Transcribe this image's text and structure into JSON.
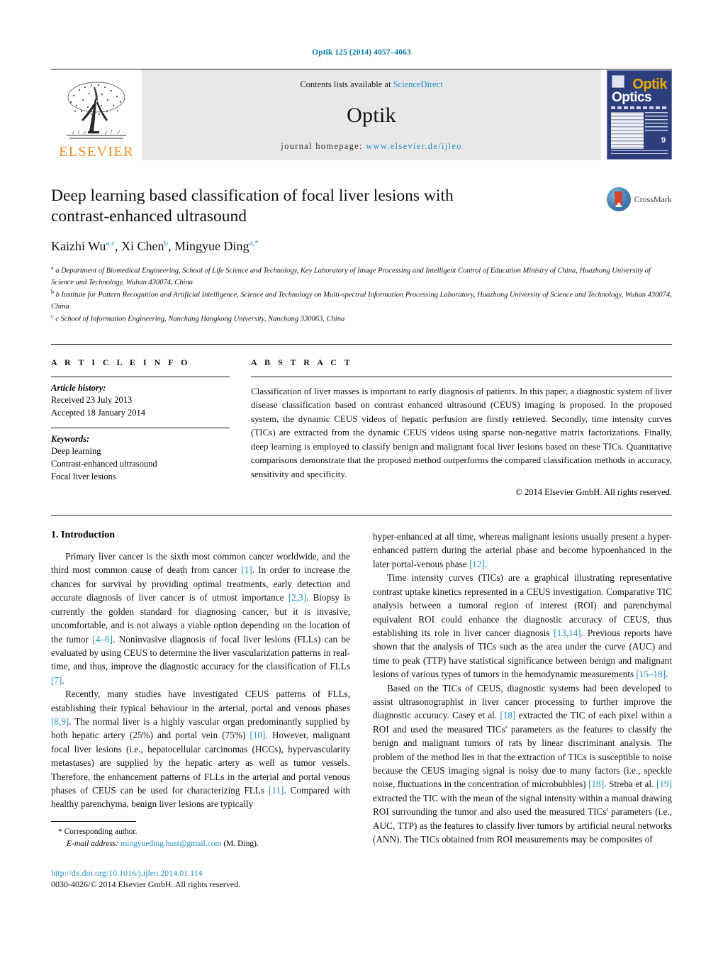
{
  "running_head": "Optik 125 (2014) 4057–4063",
  "masthead": {
    "publisher_name": "ELSEVIER",
    "contents_prefix": "Contents lists available at ",
    "sciencedirect": "ScienceDirect",
    "journal_title": "Optik",
    "homepage_prefix": "journal homepage: ",
    "homepage_url": "www.elsevier.de/ijleo",
    "cover": {
      "title_top": "Optik",
      "title_bottom": "Optics",
      "issue_number": "9"
    }
  },
  "article": {
    "title": "Deep learning based classification of focal liver lesions with contrast-enhanced ultrasound",
    "authors_html": "Kaizhi Wu<sup>a,c</sup>, Xi Chen<sup>b</sup>, Mingyue Ding<sup>a,*</sup>",
    "crossmark_label": "CrossMark",
    "affiliations": [
      "a Department of Biomedical Engineering, School of Life Science and Technology, Key Laboratory of Image Processing and Intelligent Control of Education Ministry of China, Huazhong University of Science and Technology, Wuhan 430074, China",
      "b Institute for Pattern Recognition and Artificial Intelligence, Science and Technology on Multi-spectral Information Processing Laboratory, Huazhong University of Science and Technology, Wuhan 430074, China",
      "c School of Information Engineering, Nanchang Hangkong University, Nanchang 330063, China"
    ]
  },
  "article_info": {
    "section_label": "A R T I C L E  I N F O",
    "history_label": "Article history:",
    "received": "Received 23 July 2013",
    "accepted": "Accepted 18 January 2014",
    "keywords_label": "Keywords:",
    "keywords": [
      "Deep learning",
      "Contrast-enhanced ultrasound",
      "Focal liver lesions"
    ]
  },
  "abstract": {
    "section_label": "A B S T R A C T",
    "text": "Classification of liver masses is important to early diagnosis of patients. In this paper, a diagnostic system of liver disease classification based on contrast enhanced ultrasound (CEUS) imaging is proposed. In the proposed system, the dynamic CEUS videos of hepatic perfusion are firstly retrieved. Secondly, time intensity curves (TICs) are extracted from the dynamic CEUS videos using sparse non-negative matrix factorizations. Finally, deep learning is employed to classify benign and malignant focal liver lesions based on these TICs. Quantitative comparisons demonstrate that the proposed method outperforms the compared classification methods in accuracy, sensitivity and specificity.",
    "copyright": "© 2014 Elsevier GmbH. All rights reserved."
  },
  "body": {
    "section_heading": "1.  Introduction",
    "left_paragraphs": [
      "Primary liver cancer is the sixth most common cancer worldwide, and the third most common cause of death from cancer [1]. In order to increase the chances for survival by providing optimal treatments, early detection and accurate diagnosis of liver cancer is of utmost importance [2,3]. Biopsy is currently the golden standard for diagnosing cancer, but it is invasive, uncomfortable, and is not always a viable option depending on the location of the tumor [4–6]. Noninvasive diagnosis of focal liver lesions (FLLs) can be evaluated by using CEUS to determine the liver vascularization patterns in real-time, and thus, improve the diagnostic accuracy for the classification of FLLs [7].",
      "Recently, many studies have investigated CEUS patterns of FLLs, establishing their typical behaviour in the arterial, portal and venous phases [8,9]. The normal liver is a highly vascular organ predominantly supplied by both hepatic artery (25%) and portal vein (75%) [10]. However, malignant focal liver lesions (i.e., hepatocellular carcinomas (HCCs), hypervascularity metastases) are supplied by the hepatic artery as well as tumor vessels. Therefore, the enhancement patterns of FLLs in the arterial and portal venous phases of CEUS can be used for characterizing FLLs [11]. Compared with healthy parenchyma, benign liver lesions are typically"
    ],
    "right_paragraphs": [
      "hyper-enhanced at all time, whereas malignant lesions usually present a hyper-enhanced pattern during the arterial phase and become hypoenhanced in the later portal-venous phase [12].",
      "Time intensity curves (TICs) are a graphical illustrating representative contrast uptake kinetics represented in a CEUS investigation. Comparative TIC analysis between a tumoral region of interest (ROI) and parenchymal equivalent ROI could enhance the diagnostic accuracy of CEUS, thus establishing its role in liver cancer diagnosis [13,14]. Previous reports have shown that the analysis of TICs such as the area under the curve (AUC) and time to peak (TTP) have statistical significance between benign and malignant lesions of various types of tumors in the hemodynamic measurements [15–18].",
      "Based on the TICs of CEUS, diagnostic systems had been developed to assist ultrasonographist in liver cancer processing to further improve the diagnostic accuracy. Casey et al. [18] extracted the TIC of each pixel within a ROI and used the measured TICs' parameters as the features to classify the benign and malignant tumors of rats by linear discriminant analysis. The problem of the method lies in that the extraction of TICs is susceptible to noise because the CEUS imaging signal is noisy due to many factors (i.e., speckle noise, fluctuations in the concentration of microbubbles) [18]. Streba et al. [19] extracted the TIC with the mean of the signal intensity within a manual drawing ROI surrounding the tumor and also used the measured TICs' parameters (i.e., AUC, TTP) as the features to classify liver tumors by artificial neural networks (ANN). The TICs obtained from ROI measurements may be composites of"
    ]
  },
  "footnote": {
    "corresponding_marker": "*",
    "corresponding_text": "Corresponding author.",
    "email_label": "E-mail address:",
    "email": "mingyueding.hust@gmail.com",
    "email_suffix": "(M. Ding).",
    "doi": "http://dx.doi.org/10.1016/j.ijleo.2014.01.114",
    "issn_line": "0030-4026/© 2014 Elsevier GmbH. All rights reserved."
  },
  "colors": {
    "link": "#1f8fc4",
    "elsevier_orange": "#f08c1a",
    "cover_blue": "#2c3f7c"
  }
}
